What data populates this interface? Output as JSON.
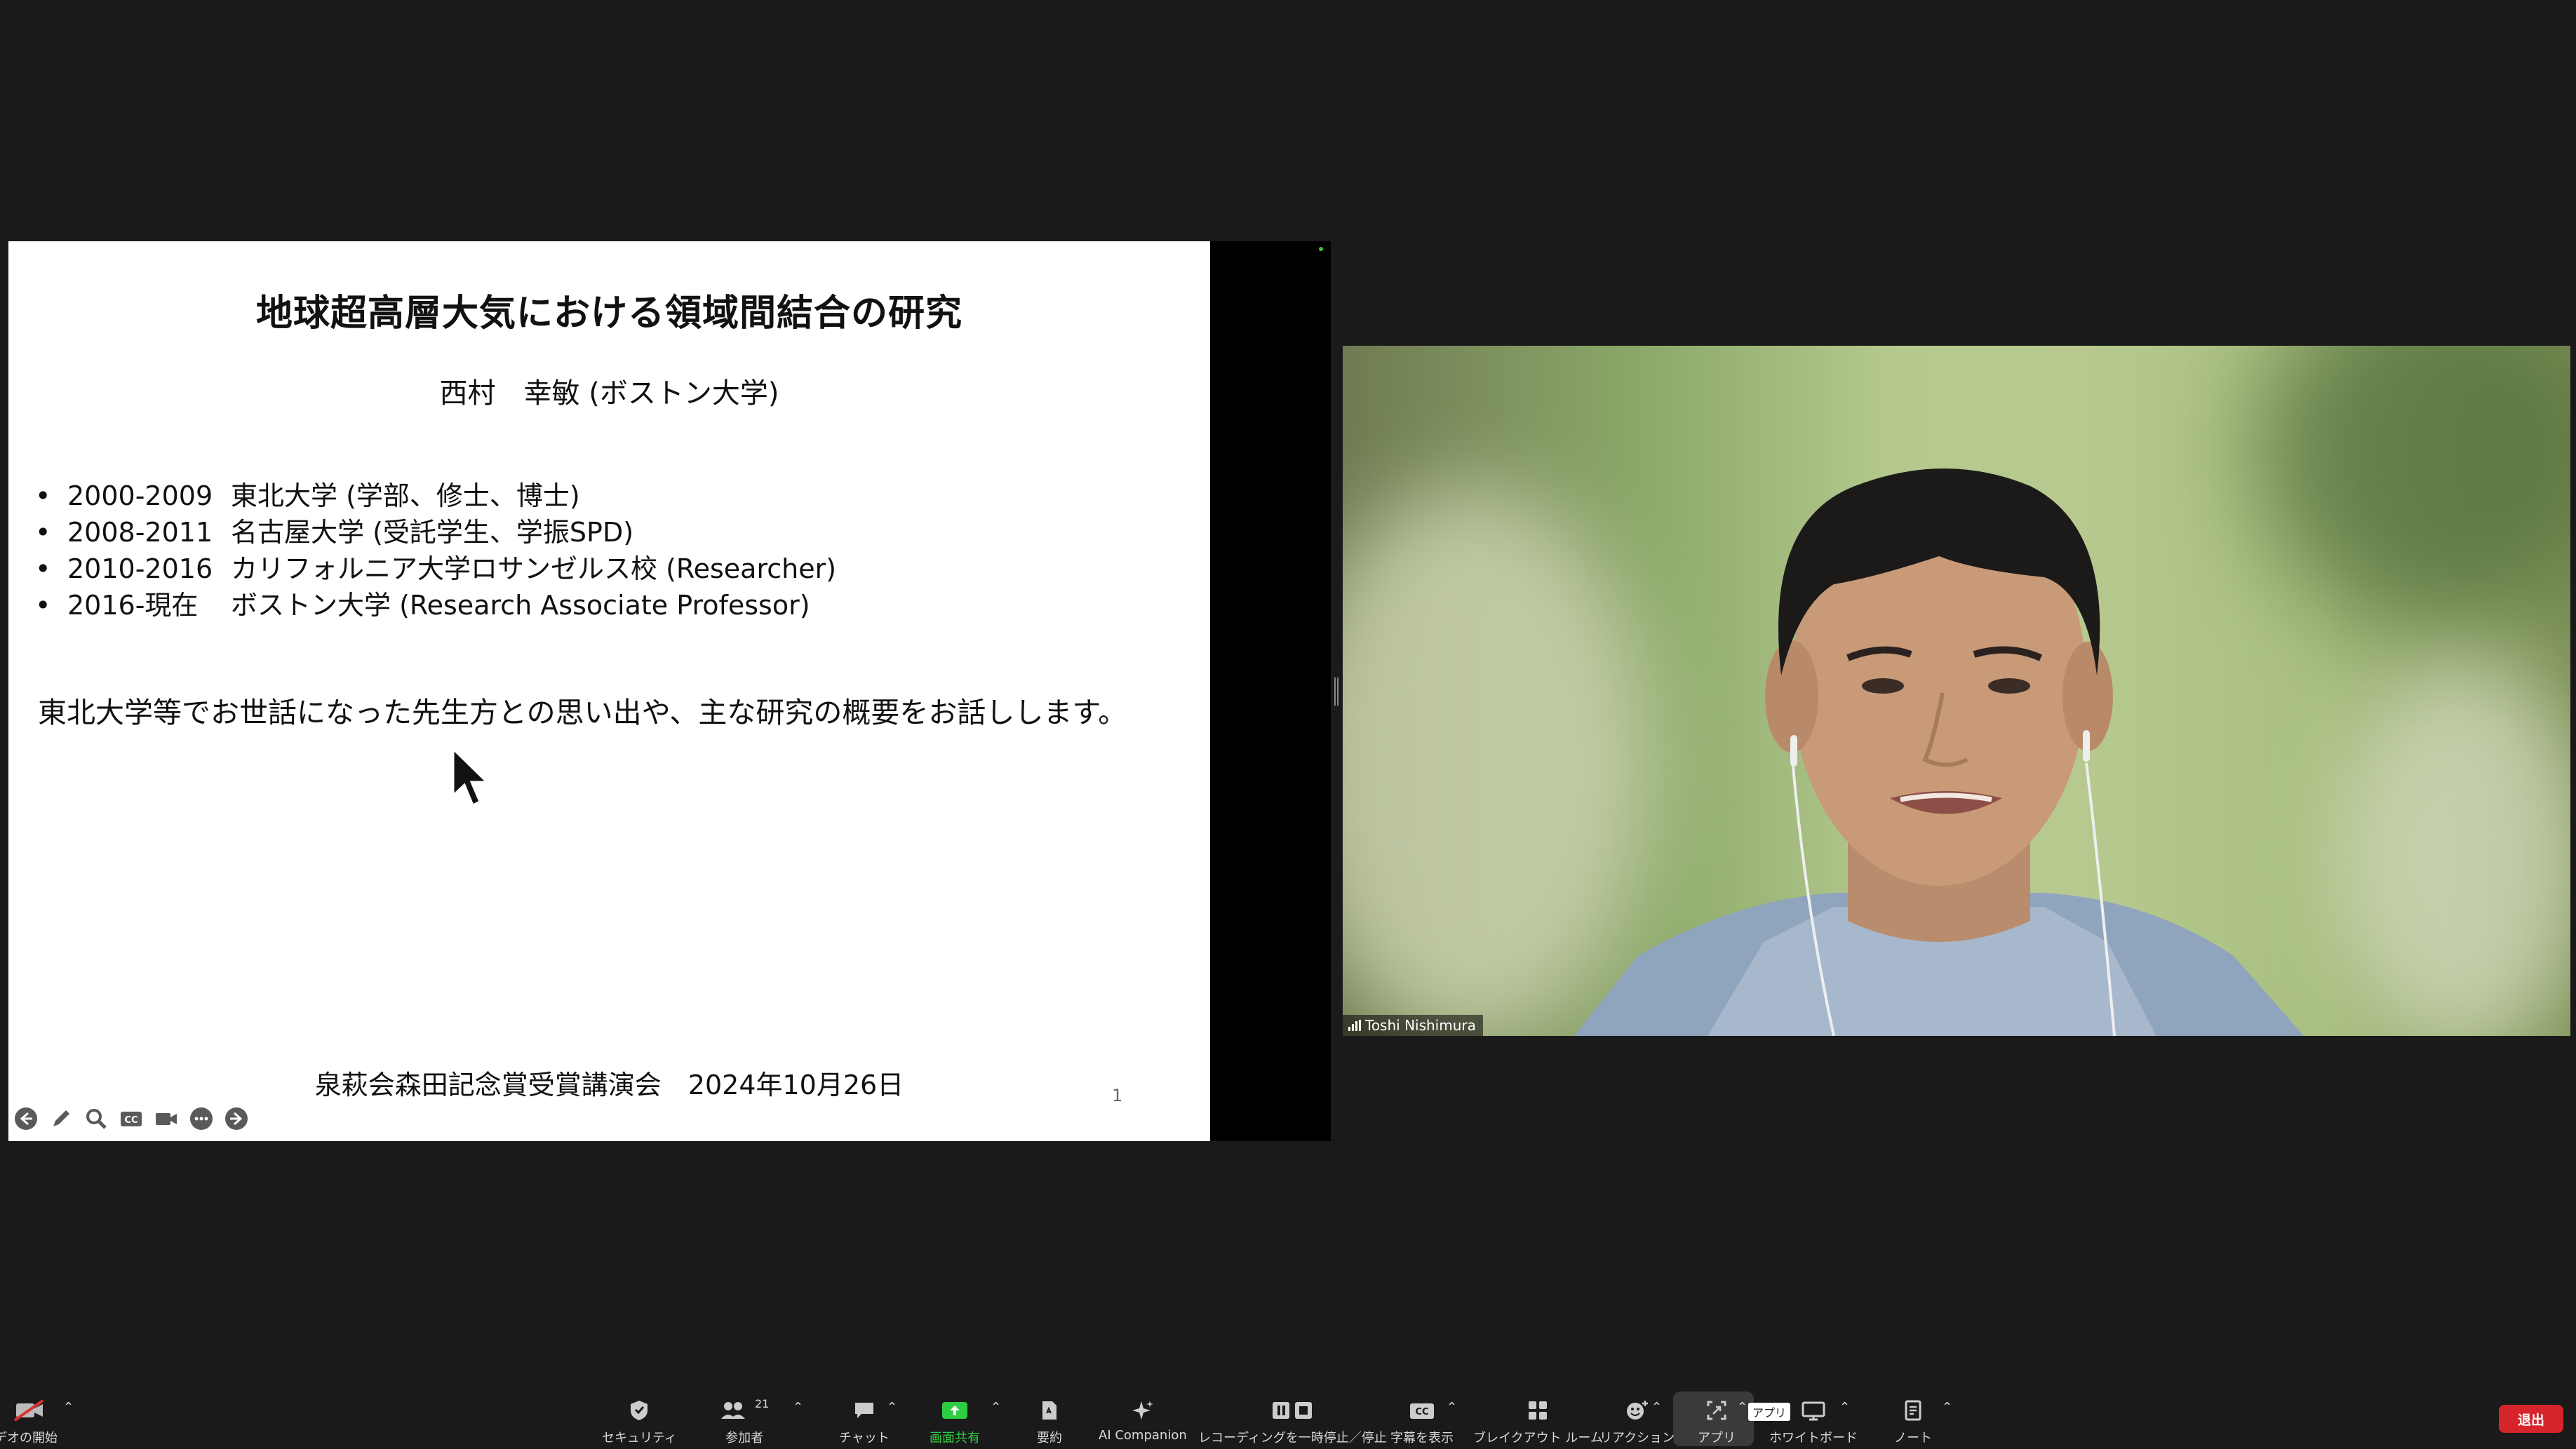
{
  "slide": {
    "title": "地球超高層大気における領域間結合の研究",
    "author": "西村　幸敏 (ボストン大学)",
    "bullets": [
      {
        "years": "2000-2009",
        "text": "東北大学 (学部、修士、博士)"
      },
      {
        "years": "2008-2011",
        "text": "名古屋大学 (受託学生、学振SPD)"
      },
      {
        "years": "2010-2016",
        "text": "カリフォルニア大学ロサンゼルス校 (Researcher)"
      },
      {
        "years": "2016-現在",
        "text": "ボストン大学 (Research Associate Professor)"
      }
    ],
    "body": "東北大学等でお世話になった先生方との思い出や、主な研究の概要をお話しします。",
    "footer": "泉萩会森田記念賞受賞講演会　2024年10月26日",
    "page_number": "1"
  },
  "presenter_controls": [
    "prev-icon",
    "pen-icon",
    "zoom-icon",
    "captions-icon",
    "camera-icon",
    "more-icon",
    "next-icon"
  ],
  "participant": {
    "name": "Toshi Nishimura"
  },
  "toolbar": {
    "video_label": "ビデオの開始",
    "security_label": "セキュリティ",
    "participants_label": "参加者",
    "participants_count": "21",
    "chat_label": "チャット",
    "share_label": "画面共有",
    "summary_label": "要約",
    "ai_label": "AI Companion",
    "recording_label": "レコーディングを一時停止／停止",
    "captions_label": "字幕を表示",
    "breakout_label": "ブレイクアウト ルーム",
    "reactions_label": "リアクション",
    "apps_label": "アプリ",
    "apps_tooltip": "アプリ",
    "whiteboard_label": "ホワイトボード",
    "notes_label": "ノート",
    "leave_label": "退出"
  },
  "colors": {
    "background": "#1a1a1a",
    "share_green": "#2ecc40",
    "leave_red": "#d6242c"
  }
}
